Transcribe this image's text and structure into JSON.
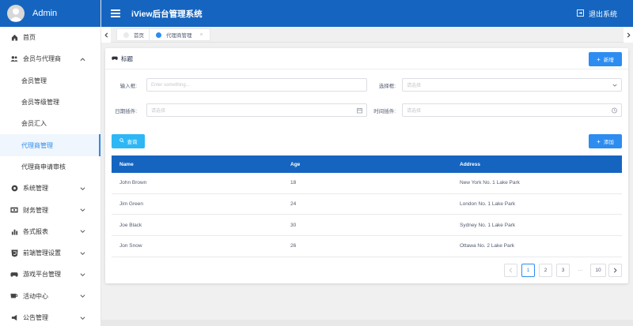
{
  "sidebar": {
    "admin_name": "Admin",
    "items": [
      {
        "label": "首页",
        "icon": "home-icon"
      },
      {
        "label": "会员与代理商",
        "icon": "users-icon"
      },
      {
        "label": "会员管理"
      },
      {
        "label": "会员等级管理"
      },
      {
        "label": "会员汇入"
      },
      {
        "label": "代理商管理"
      },
      {
        "label": "代理商申请审核"
      },
      {
        "label": "系统管理",
        "icon": "settings-icon"
      },
      {
        "label": "财务管理",
        "icon": "finance-icon"
      },
      {
        "label": "各式报表",
        "icon": "chart-icon"
      },
      {
        "label": "前端管理设置",
        "icon": "html5-icon"
      },
      {
        "label": "游戏平台管理",
        "icon": "gamepad-icon"
      },
      {
        "label": "活动中心",
        "icon": "coffee-icon"
      },
      {
        "label": "公告管理",
        "icon": "megaphone-icon"
      }
    ]
  },
  "header": {
    "title": "iView后台管理系统",
    "logout_label": "退出系统"
  },
  "tabs": [
    {
      "label": "首页",
      "dot_color": "#e8eaec"
    },
    {
      "label": "代理商管理",
      "dot_color": "#2d8cf0",
      "close": "×"
    }
  ],
  "card": {
    "title": "标题",
    "add_new_label": "新增",
    "form": {
      "input_label": "输入框:",
      "input_placeholder": "Enter something...",
      "select_label": "选择框:",
      "select_placeholder": "请选择",
      "date_label": "日期插件:",
      "date_placeholder": "请选择",
      "time_label": "时间插件:",
      "time_placeholder": "请选择"
    },
    "query_label": "查询",
    "add_label": "添加"
  },
  "table": {
    "columns": [
      "Name",
      "Age",
      "Address"
    ],
    "rows": [
      [
        "John Brown",
        "18",
        "New York No. 1 Lake Park"
      ],
      [
        "Jim Green",
        "24",
        "London No. 1 Lake Park"
      ],
      [
        "Joe Black",
        "30",
        "Sydney No. 1 Lake Park"
      ],
      [
        "Jon Snow",
        "26",
        "Ottawa No. 2 Lake Park"
      ]
    ]
  },
  "pagination": {
    "pages": [
      "1",
      "2",
      "3"
    ],
    "ellipsis": "···",
    "last_page": "10",
    "current": "1"
  },
  "colors": {
    "primary": "#1565c0",
    "accent": "#2d8cf0",
    "info": "#2db7f5"
  }
}
